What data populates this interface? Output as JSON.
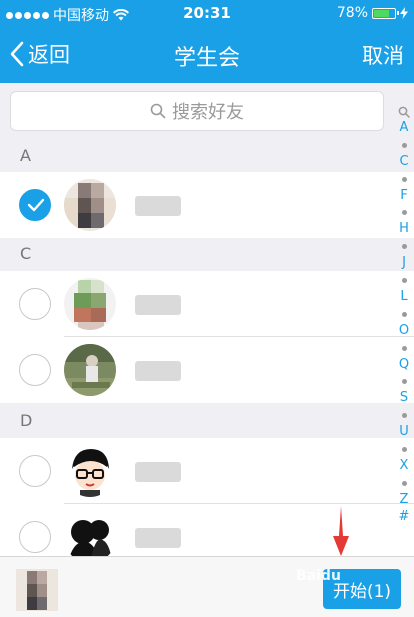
{
  "status": {
    "carrier": "中国移动",
    "time": "20:31",
    "battery": "78%",
    "battery_level": 0.78
  },
  "nav": {
    "back_label": "返回",
    "title": "学生会",
    "cancel_label": "取消"
  },
  "search": {
    "placeholder": "搜索好友"
  },
  "sections": [
    {
      "letter": "A"
    },
    {
      "letter": "C"
    },
    {
      "letter": "D"
    }
  ],
  "rows": [
    {
      "checked": true
    },
    {
      "checked": false
    },
    {
      "checked": false
    },
    {
      "checked": false
    },
    {
      "checked": false
    }
  ],
  "index_bar": [
    "A",
    "C",
    "F",
    "H",
    "J",
    "L",
    "O",
    "Q",
    "S",
    "U",
    "X",
    "Z",
    "#"
  ],
  "bottom": {
    "start_label": "开始(1)"
  },
  "watermark": "Baidu",
  "colors": {
    "accent": "#1aa0e6",
    "arrow": "#e53935"
  }
}
